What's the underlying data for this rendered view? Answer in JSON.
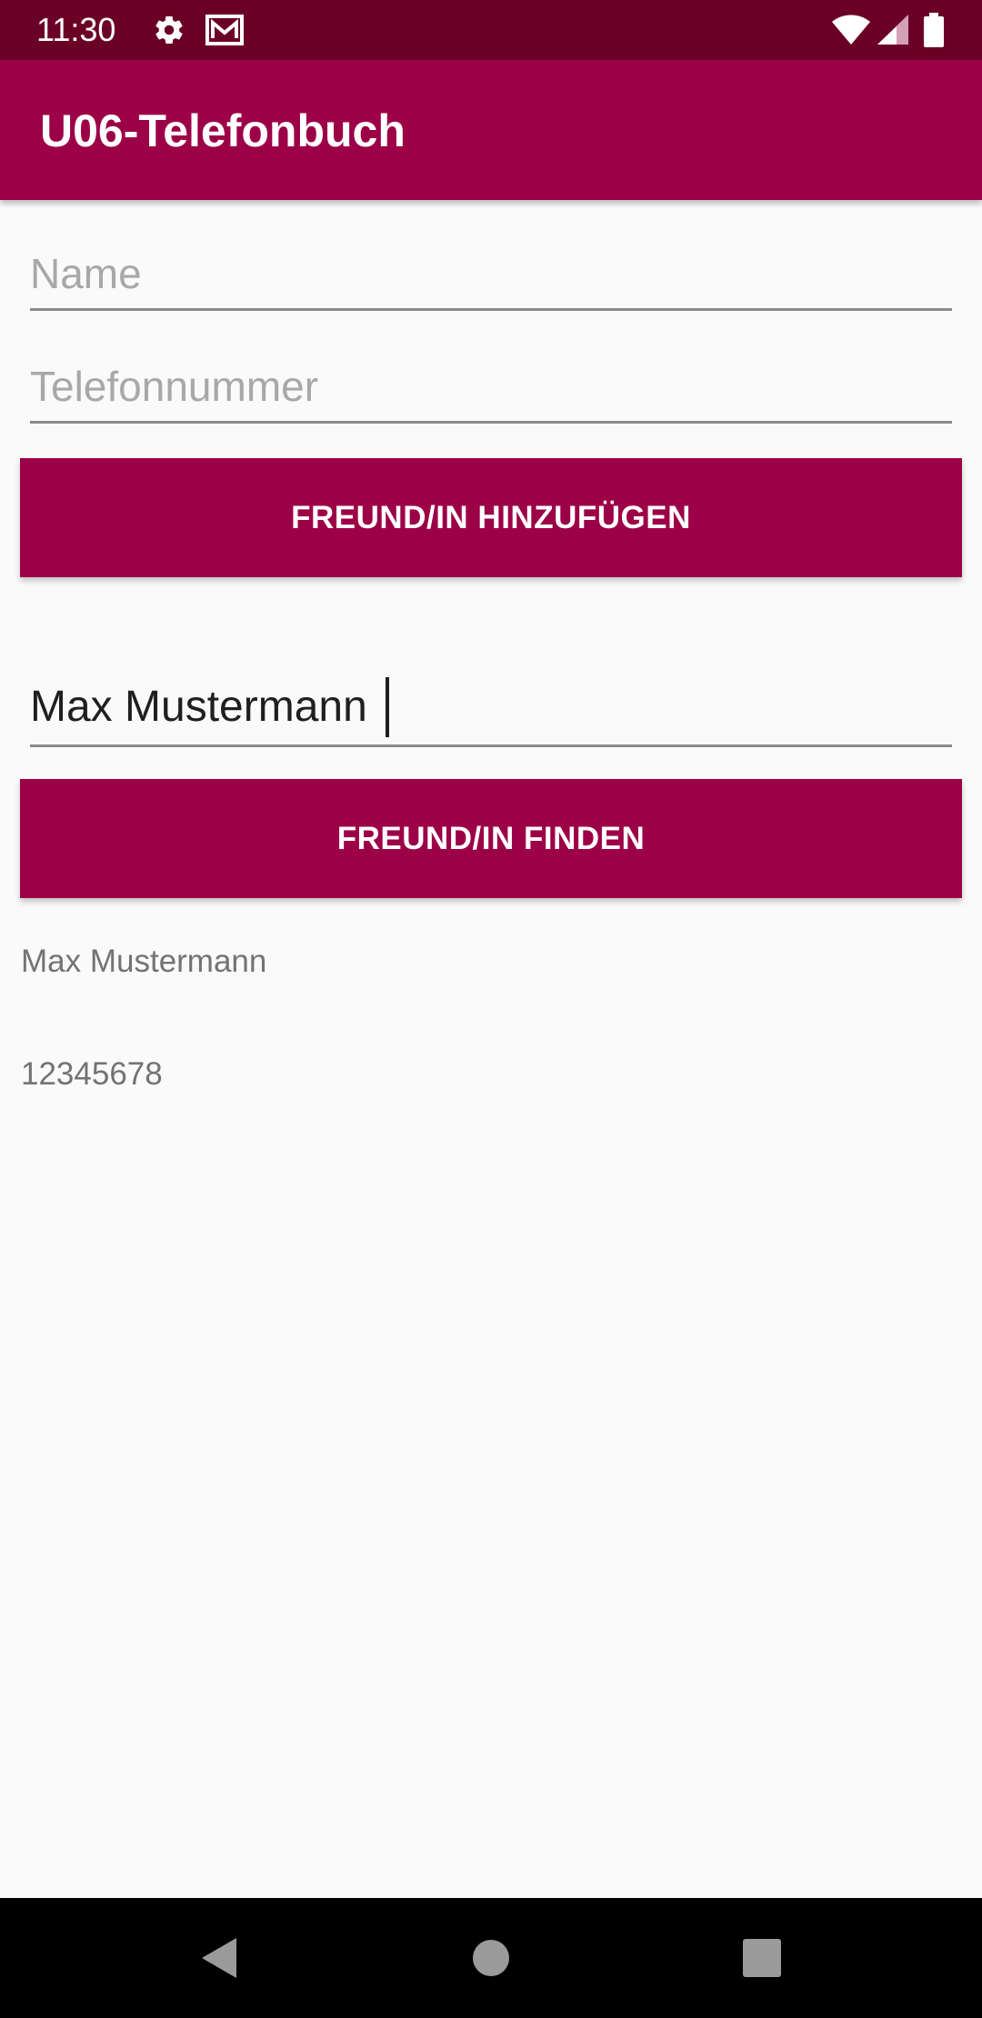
{
  "status_bar": {
    "time": "11:30",
    "icons": [
      "gear-icon",
      "gmail-icon",
      "wifi-icon",
      "signal-icon",
      "battery-icon"
    ]
  },
  "app_bar": {
    "title": "U06-Telefonbuch",
    "color": "#9c0046"
  },
  "form": {
    "name_placeholder": "Name",
    "phone_placeholder": "Telefonnummer",
    "add_button_label": "FREUND/IN HINZUFÜGEN"
  },
  "search": {
    "value": "Max Mustermann",
    "find_button_label": "FREUND/IN FINDEN"
  },
  "result": {
    "name": "Max Mustermann",
    "phone": "12345678"
  },
  "nav_bar": {
    "icons": [
      "back-icon",
      "home-icon",
      "recents-icon"
    ]
  },
  "colors": {
    "status_bar": "#6b0026",
    "accent": "#9c0046",
    "background": "#fafafa"
  }
}
